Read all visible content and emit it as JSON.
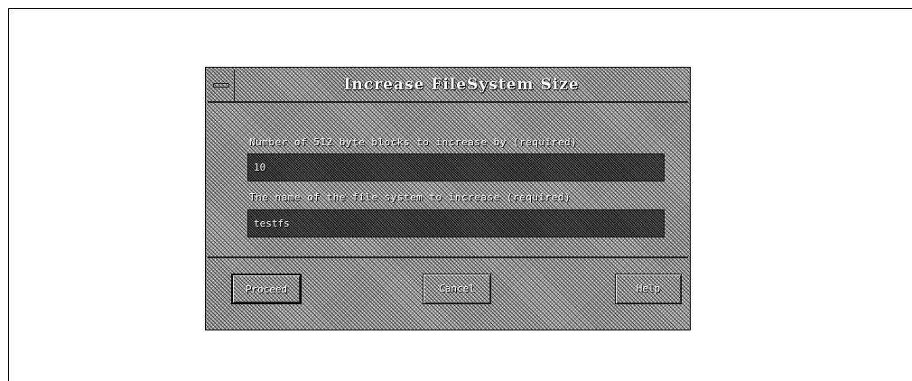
{
  "dialog": {
    "title": "Increase FileSystem Size",
    "fields": [
      {
        "label": "Number of 512 byte blocks to increase by (required)",
        "value": "10"
      },
      {
        "label": "The name of the file system to increase (required)",
        "value": "testfs"
      }
    ],
    "buttons": {
      "proceed": "Proceed",
      "cancel": "Cancel",
      "help": "Help"
    }
  },
  "icons": {
    "window_menu": "window-menu-icon"
  }
}
